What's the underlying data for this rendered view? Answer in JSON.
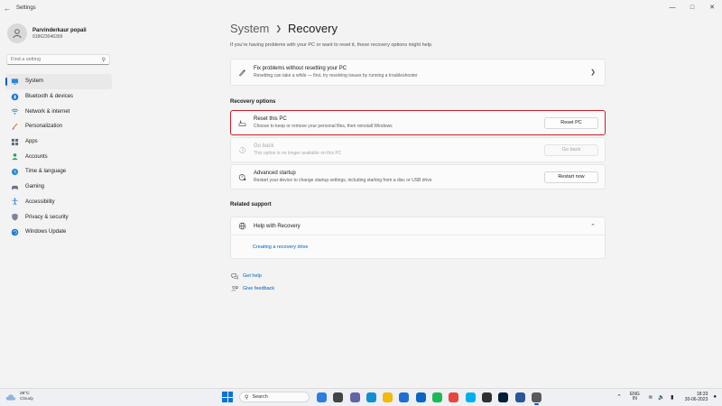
{
  "window": {
    "title": "Settings",
    "back_icon": "back-arrow-icon",
    "controls": [
      "minimize-icon",
      "maximize-icon",
      "close-icon"
    ]
  },
  "profile": {
    "name": "Parvinderkaur popali",
    "email": "918623046399"
  },
  "search": {
    "placeholder": "Find a setting"
  },
  "sidebar": {
    "items": [
      {
        "label": "System",
        "icon": "monitor-icon",
        "active": true
      },
      {
        "label": "Bluetooth & devices",
        "icon": "bluetooth-icon"
      },
      {
        "label": "Network & internet",
        "icon": "wifi-icon"
      },
      {
        "label": "Personalization",
        "icon": "paintbrush-icon"
      },
      {
        "label": "Apps",
        "icon": "apps-icon"
      },
      {
        "label": "Accounts",
        "icon": "accounts-icon"
      },
      {
        "label": "Time & language",
        "icon": "globe-clock-icon"
      },
      {
        "label": "Gaming",
        "icon": "gamepad-icon"
      },
      {
        "label": "Accessibility",
        "icon": "accessibility-icon"
      },
      {
        "label": "Privacy & security",
        "icon": "shield-icon"
      },
      {
        "label": "Windows Update",
        "icon": "update-icon"
      }
    ]
  },
  "main": {
    "breadcrumb_parent": "System",
    "breadcrumb_current": "Recovery",
    "intro": "If you're having problems with your PC or want to reset it, these recovery options might help.",
    "fix_card": {
      "title": "Fix problems without resetting your PC",
      "desc": "Resetting can take a while — first, try resolving issues by running a troubleshooter"
    },
    "recovery_options_label": "Recovery options",
    "reset_card": {
      "title": "Reset this PC",
      "desc": "Choose to keep or remove your personal files, then reinstall Windows",
      "button": "Reset PC"
    },
    "goback_card": {
      "title": "Go back",
      "desc": "This option is no longer available on this PC",
      "button": "Go back"
    },
    "advanced_card": {
      "title": "Advanced startup",
      "desc": "Restart your device to change startup settings, including starting from a disc or USB drive",
      "button": "Restart now"
    },
    "related_support_label": "Related support",
    "help_recovery": {
      "title": "Help with Recovery",
      "link": "Creating a recovery drive"
    },
    "get_help": "Get help",
    "give_feedback": "Give feedback"
  },
  "taskbar": {
    "weather_temp": "26°C",
    "weather_cond": "Cloudy",
    "search_label": "Search",
    "lang_line1": "ENG",
    "lang_line2": "IN",
    "time": "18:33",
    "date": "30-06-2023",
    "apps": [
      {
        "icon": "copilot-icon",
        "color": "#2d7de0"
      },
      {
        "icon": "task-view-icon",
        "color": "#444444"
      },
      {
        "icon": "teams-icon",
        "color": "#6264a7"
      },
      {
        "icon": "edge-icon",
        "color": "#0f8fd6"
      },
      {
        "icon": "file-explorer-icon",
        "color": "#f2b90c"
      },
      {
        "icon": "store-icon",
        "color": "#1f6fd0"
      },
      {
        "icon": "mail-icon",
        "color": "#0a66c2"
      },
      {
        "icon": "spotify-icon",
        "color": "#1db954"
      },
      {
        "icon": "chrome-icon",
        "color": "#e8453c"
      },
      {
        "icon": "skype-icon",
        "color": "#00aff0"
      },
      {
        "icon": "camera-icon",
        "color": "#303030"
      },
      {
        "icon": "photoshop-icon",
        "color": "#001e36"
      },
      {
        "icon": "word-icon",
        "color": "#2b579a"
      },
      {
        "icon": "settings-icon",
        "color": "#5a5a5a",
        "active": true
      }
    ]
  }
}
